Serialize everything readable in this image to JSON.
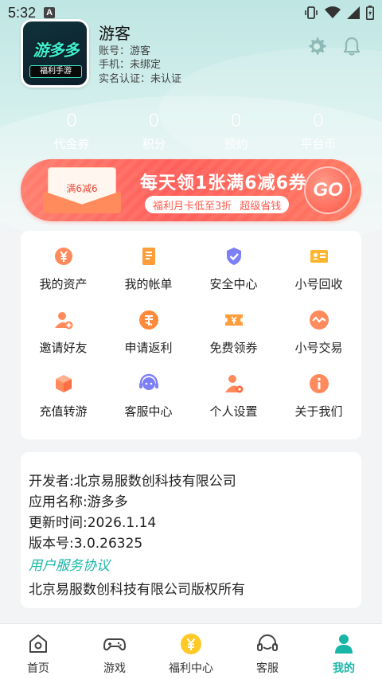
{
  "status_bar": {
    "time": "5:32",
    "notif_badge": "A",
    "icons": [
      "vibrate-icon",
      "wifi-icon",
      "signal-icon",
      "battery-icon"
    ]
  },
  "profile": {
    "name": "游客",
    "account": "账号：游客",
    "phone": "手机：未绑定",
    "realname": "实名认证：未认证",
    "logo_text": "游多多",
    "logo_sub": "福利手游"
  },
  "header_icons": [
    "settings-icon",
    "bell-icon"
  ],
  "stats": [
    {
      "value": "0",
      "label": "代金券"
    },
    {
      "value": "0",
      "label": "积分"
    },
    {
      "value": "0",
      "label": "预约"
    },
    {
      "value": "0",
      "label": "平台币"
    }
  ],
  "banner": {
    "voucher_text": "满6减6",
    "title": "每天领1张满6减6券",
    "sub_left": "福利月卡低至3折",
    "sub_right": "超级省钱",
    "go": "GO"
  },
  "menu": [
    {
      "label": "我的资产",
      "icon": "yen-coin-icon",
      "color": "#ff8a5c"
    },
    {
      "label": "我的帐单",
      "icon": "bill-icon",
      "color": "#ff9d3b"
    },
    {
      "label": "安全中心",
      "icon": "shield-check-icon",
      "color": "#7d7ff5"
    },
    {
      "label": "小号回收",
      "icon": "id-card-icon",
      "color": "#ffb52e"
    },
    {
      "label": "邀请好友",
      "icon": "invite-user-icon",
      "color": "#ff8a5c"
    },
    {
      "label": "申请返利",
      "icon": "rebate-icon",
      "color": "#ff8a3b"
    },
    {
      "label": "免费领券",
      "icon": "coupon-icon",
      "color": "#ff9d3b"
    },
    {
      "label": "小号交易",
      "icon": "trade-icon",
      "color": "#ff8a5c"
    },
    {
      "label": "充值转游",
      "icon": "cube-icon",
      "color": "#ff8a5c"
    },
    {
      "label": "客服中心",
      "icon": "headset-icon",
      "color": "#7d7ff5"
    },
    {
      "label": "个人设置",
      "icon": "user-settings-icon",
      "color": "#ff8a5c"
    },
    {
      "label": "关于我们",
      "icon": "info-icon",
      "color": "#ff8a5c"
    }
  ],
  "app_info": {
    "developer": "开发者:北京易服数创科技有限公司",
    "app_name": "应用名称:游多多",
    "updated": "更新时间:2026.1.14",
    "version": "版本号:3.0.26325",
    "agreement": "用户服务协议",
    "copyright": "北京易服数创科技有限公司版权所有"
  },
  "nav": [
    {
      "label": "首页",
      "icon": "home-icon"
    },
    {
      "label": "游戏",
      "icon": "gamepad-icon"
    },
    {
      "label": "福利中心",
      "icon": "welfare-coin-icon"
    },
    {
      "label": "客服",
      "icon": "support-icon"
    },
    {
      "label": "我的",
      "icon": "profile-icon"
    }
  ],
  "colors": {
    "accent": "#19b6a7",
    "banner": "#ff5f5a",
    "coin": "#ffc928"
  }
}
